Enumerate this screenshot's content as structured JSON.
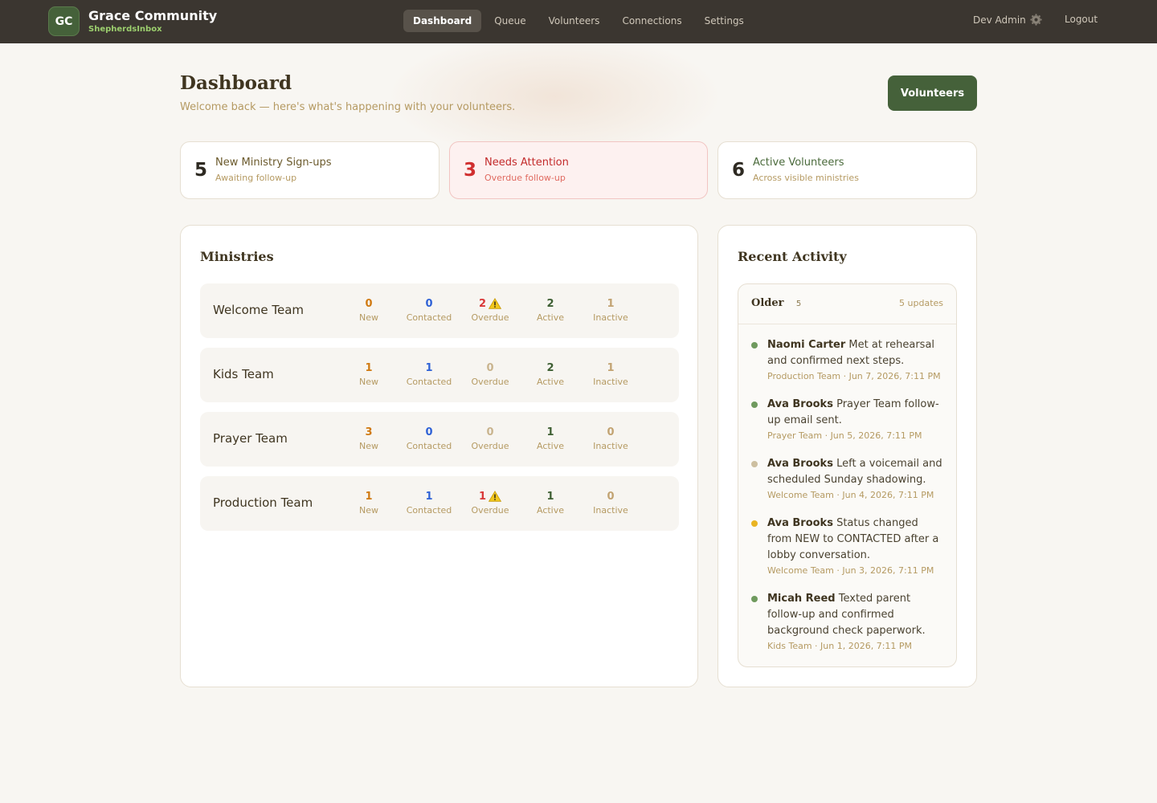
{
  "brand": {
    "logo": "GC",
    "name": "Grace Community",
    "product": "ShepherdsInbox"
  },
  "nav": {
    "items": [
      "Dashboard",
      "Queue",
      "Volunteers",
      "Connections",
      "Settings"
    ],
    "active": "Dashboard"
  },
  "user": {
    "name": "Dev Admin",
    "logout": "Logout"
  },
  "header": {
    "title": "Dashboard",
    "subtitle": "Welcome back — here's what's happening with your volunteers.",
    "cta": "Volunteers"
  },
  "stats": [
    {
      "value": "5",
      "label": "New Ministry Sign-ups",
      "sub": "Awaiting follow-up"
    },
    {
      "value": "3",
      "label": "Needs Attention",
      "sub": "Overdue follow-up"
    },
    {
      "value": "6",
      "label": "Active Volunteers",
      "sub": "Across visible ministries"
    }
  ],
  "ministries": {
    "title": "Ministries",
    "metric_labels": [
      "New",
      "Contacted",
      "Overdue",
      "Active",
      "Inactive"
    ],
    "rows": [
      {
        "name": "Welcome Team",
        "values": [
          "0",
          "0",
          "2",
          "2",
          "1"
        ],
        "overdue_warning": true
      },
      {
        "name": "Kids Team",
        "values": [
          "1",
          "1",
          "0",
          "2",
          "1"
        ],
        "overdue_warning": false
      },
      {
        "name": "Prayer Team",
        "values": [
          "3",
          "0",
          "0",
          "1",
          "0"
        ],
        "overdue_warning": false
      },
      {
        "name": "Production Team",
        "values": [
          "1",
          "1",
          "1",
          "1",
          "0"
        ],
        "overdue_warning": true
      }
    ]
  },
  "activity": {
    "title": "Recent Activity",
    "group_label": "Older",
    "group_count": "5",
    "group_updates": "5 updates",
    "items": [
      {
        "who": "Naomi Carter",
        "text": "Met at rehearsal and confirmed next steps.",
        "meta": "Production Team · Jun 7, 2026, 7:11 PM"
      },
      {
        "who": "Ava Brooks",
        "text": "Prayer Team follow-up email sent.",
        "meta": "Prayer Team · Jun 5, 2026, 7:11 PM"
      },
      {
        "who": "Ava Brooks",
        "text": "Left a voicemail and scheduled Sunday shadowing.",
        "meta": "Welcome Team · Jun 4, 2026, 7:11 PM"
      },
      {
        "who": "Ava Brooks",
        "text": "Status changed from NEW to CONTACTED after a lobby conversation.",
        "meta": "Welcome Team · Jun 3, 2026, 7:11 PM"
      },
      {
        "who": "Micah Reed",
        "text": "Texted parent follow-up and confirmed background check paperwork.",
        "meta": "Kids Team · Jun 1, 2026, 7:11 PM"
      }
    ]
  },
  "colors": {
    "brand_green": "#45613a",
    "new": "#d07a12",
    "contacted": "#2f62d6",
    "overdue": "#d93838",
    "overdue_zero": "#c9b48e",
    "active": "#3e5f33",
    "inactive": "#c2a372",
    "dot_green": "#6f9a5e",
    "dot_tan": "#cdbfa0",
    "dot_yellow": "#e9b422"
  }
}
